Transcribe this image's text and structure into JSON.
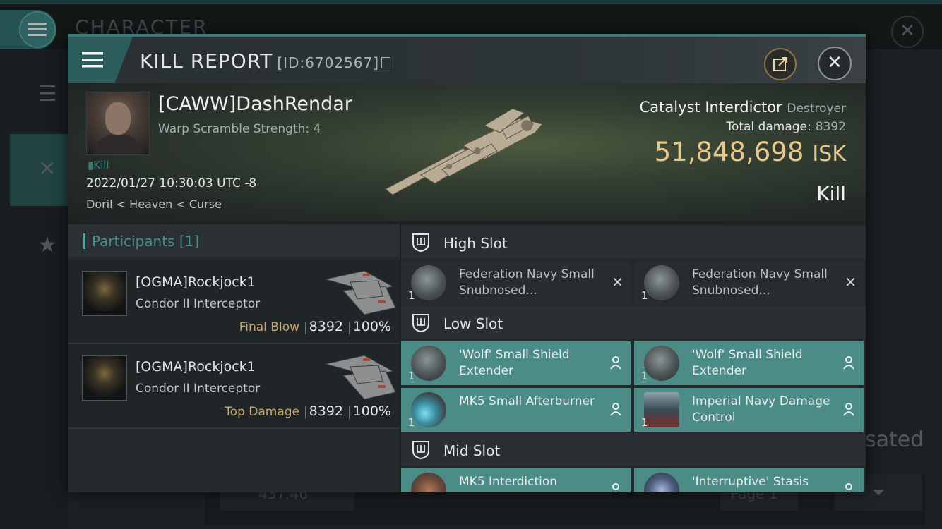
{
  "background": {
    "title": "CHARACTER",
    "right_text": "sated",
    "stat_value": "437.46",
    "page_label": "Page 1"
  },
  "header": {
    "title": "KILL REPORT",
    "id_label": "[ID:6702567]"
  },
  "victim": {
    "name": "[CAWW]DashRendar",
    "warp_scramble": "Warp Scramble Strength: 4",
    "tag": "Kill",
    "datetime": "2022/01/27 10:30:03 UTC -8",
    "location": "Doril < Heaven < Curse"
  },
  "ship": {
    "name": "Catalyst Interdictor",
    "class": "Destroyer",
    "damage_label": "Total damage:",
    "damage_value": "8392",
    "isk_value": "51,848,698",
    "isk_unit": "ISK",
    "result": "Kill"
  },
  "participants": {
    "title": "Participants",
    "count": "[1]",
    "rows": [
      {
        "name": "[OGMA]Rockjock1",
        "ship": "Condor II Interceptor",
        "role": "Final Blow",
        "damage": "8392",
        "percent": "100%"
      },
      {
        "name": "[OGMA]Rockjock1",
        "ship": "Condor II Interceptor",
        "role": "Top Damage",
        "damage": "8392",
        "percent": "100%"
      }
    ]
  },
  "slots": {
    "high": {
      "title": "High Slot",
      "modules": [
        {
          "name": "Federation Navy Small Snubnosed...",
          "qty": "1"
        },
        {
          "name": "Federation Navy Small Snubnosed...",
          "qty": "1"
        }
      ]
    },
    "low": {
      "title": "Low Slot",
      "modules": [
        {
          "name": "'Wolf' Small Shield Extender",
          "qty": "1"
        },
        {
          "name": "'Wolf' Small Shield Extender",
          "qty": "1"
        },
        {
          "name": "MK5 Small Afterburner",
          "qty": "1"
        },
        {
          "name": "Imperial Navy Damage Control",
          "qty": "1"
        }
      ]
    },
    "mid": {
      "title": "Mid Slot",
      "modules": [
        {
          "name": "MK5 Interdiction",
          "qty": "1"
        },
        {
          "name": "'Interruptive' Stasis",
          "qty": "1"
        }
      ]
    }
  },
  "colors": {
    "accent": "#4b8c86",
    "isk": "#e7c98b",
    "role": "#c9a66a"
  }
}
